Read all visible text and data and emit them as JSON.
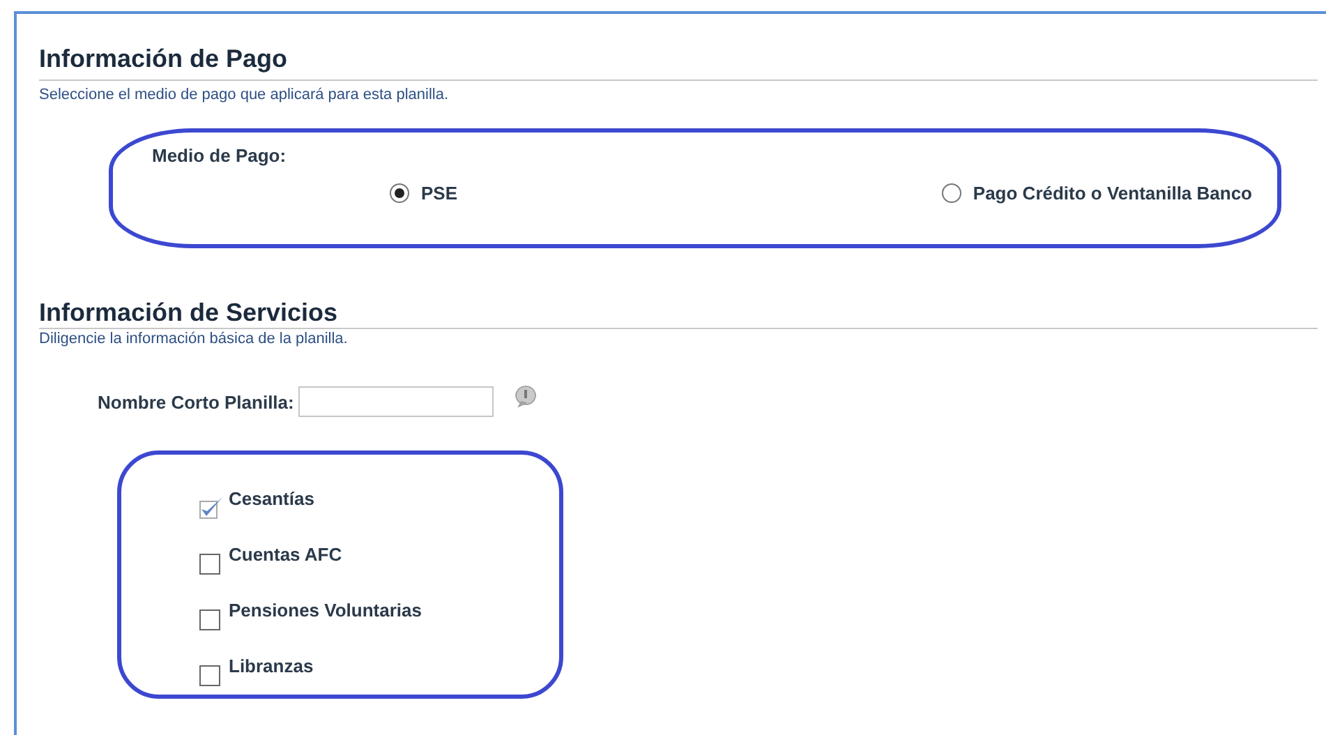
{
  "payment": {
    "title": "Información de Pago",
    "subtitle": "Seleccione el medio de pago que aplicará para esta planilla.",
    "method_label": "Medio de Pago:",
    "options": [
      {
        "label": "PSE",
        "selected": true
      },
      {
        "label": "Pago Crédito o Ventanilla Banco",
        "selected": false
      }
    ]
  },
  "services": {
    "title": "Información de Servicios",
    "subtitle": "Diligencie la información básica de la planilla.",
    "short_name": {
      "label": "Nombre Corto Planilla:"
    },
    "items": [
      {
        "label": "Cesantías",
        "checked": true
      },
      {
        "label": "Cuentas AFC",
        "checked": false
      },
      {
        "label": "Pensiones Voluntarias",
        "checked": false
      },
      {
        "label": "Libranzas",
        "checked": false
      }
    ]
  }
}
